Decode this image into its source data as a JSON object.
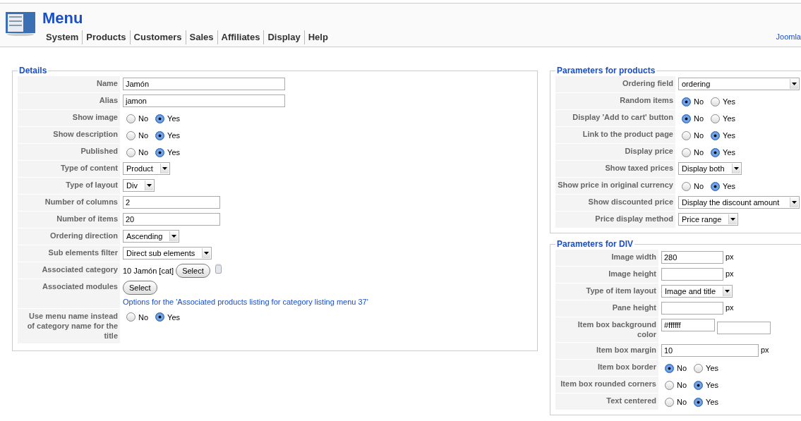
{
  "header": {
    "title": "Menu",
    "nav": [
      "System",
      "Products",
      "Customers",
      "Sales",
      "Affiliates",
      "Display",
      "Help"
    ],
    "link": "Joomla"
  },
  "details": {
    "legend": "Details",
    "rows": [
      {
        "kind": "text",
        "label": "Name",
        "value": "Jamón"
      },
      {
        "kind": "text",
        "label": "Alias",
        "value": "jamon"
      },
      {
        "kind": "radio",
        "label": "Show image",
        "options": [
          {
            "label": "No",
            "selected": false
          },
          {
            "label": "Yes",
            "selected": true
          }
        ]
      },
      {
        "kind": "radio",
        "label": "Show description",
        "options": [
          {
            "label": "No",
            "selected": false
          },
          {
            "label": "Yes",
            "selected": true
          }
        ]
      },
      {
        "kind": "radio",
        "label": "Published",
        "options": [
          {
            "label": "No",
            "selected": false
          },
          {
            "label": "Yes",
            "selected": true
          }
        ]
      },
      {
        "kind": "select",
        "label": "Type of content",
        "value": "Product"
      },
      {
        "kind": "select",
        "label": "Type of layout",
        "value": "Div"
      },
      {
        "kind": "number",
        "label": "Number of columns",
        "value": "2"
      },
      {
        "kind": "number",
        "label": "Number of items",
        "value": "20"
      },
      {
        "kind": "select",
        "label": "Ordering direction",
        "value": "Ascending"
      },
      {
        "kind": "select",
        "label": "Sub elements filter",
        "value": "Direct sub elements"
      },
      {
        "kind": "category",
        "label": "Associated category",
        "value": "10 Jamón [cat]",
        "button": "Select"
      },
      {
        "kind": "modules",
        "label": "Associated modules",
        "button": "Select",
        "link": "Options for the 'Associated products listing for category listing menu 37'"
      },
      {
        "kind": "radio",
        "label": "Use menu name instead of category name for the title",
        "options": [
          {
            "label": "No",
            "selected": false
          },
          {
            "label": "Yes",
            "selected": true
          }
        ]
      }
    ]
  },
  "products": {
    "legend": "Parameters for products",
    "rows": [
      {
        "kind": "select_wide",
        "label": "Ordering field",
        "value": "ordering"
      },
      {
        "kind": "radio",
        "label": "Random items",
        "options": [
          {
            "label": "No",
            "selected": true
          },
          {
            "label": "Yes",
            "selected": false
          }
        ]
      },
      {
        "kind": "radio",
        "label": "Display 'Add to cart' button",
        "options": [
          {
            "label": "No",
            "selected": true
          },
          {
            "label": "Yes",
            "selected": false
          }
        ]
      },
      {
        "kind": "radio",
        "label": "Link to the product page",
        "options": [
          {
            "label": "No",
            "selected": false
          },
          {
            "label": "Yes",
            "selected": true
          }
        ]
      },
      {
        "kind": "radio",
        "label": "Display price",
        "options": [
          {
            "label": "No",
            "selected": false
          },
          {
            "label": "Yes",
            "selected": true
          }
        ]
      },
      {
        "kind": "select",
        "label": "Show taxed prices",
        "value": "Display both"
      },
      {
        "kind": "radio",
        "label": "Show price in original currency",
        "options": [
          {
            "label": "No",
            "selected": false
          },
          {
            "label": "Yes",
            "selected": true
          }
        ]
      },
      {
        "kind": "select_wide",
        "label": "Show discounted price",
        "value": "Display the discount amount"
      },
      {
        "kind": "select",
        "label": "Price display method",
        "value": "Price range"
      }
    ]
  },
  "div": {
    "legend": "Parameters for DIV",
    "rows": [
      {
        "kind": "short",
        "label": "Image width",
        "value": "280",
        "unit": "px"
      },
      {
        "kind": "short",
        "label": "Image height",
        "unit": "px"
      },
      {
        "kind": "select",
        "label": "Type of item layout",
        "value": "Image and title"
      },
      {
        "kind": "short",
        "label": "Pane height",
        "unit": "px"
      },
      {
        "kind": "color",
        "label": "Item box background color",
        "value": "#ffffff"
      },
      {
        "kind": "number",
        "label": "Item box margin",
        "value": "10",
        "unit": "px"
      },
      {
        "kind": "radio",
        "label": "Item box border",
        "options": [
          {
            "label": "No",
            "selected": true
          },
          {
            "label": "Yes",
            "selected": false
          }
        ]
      },
      {
        "kind": "radio",
        "label": "Item box rounded corners",
        "options": [
          {
            "label": "No",
            "selected": false
          },
          {
            "label": "Yes",
            "selected": true
          }
        ]
      },
      {
        "kind": "radio",
        "label": "Text centered",
        "options": [
          {
            "label": "No",
            "selected": false
          },
          {
            "label": "Yes",
            "selected": true
          }
        ]
      }
    ]
  }
}
